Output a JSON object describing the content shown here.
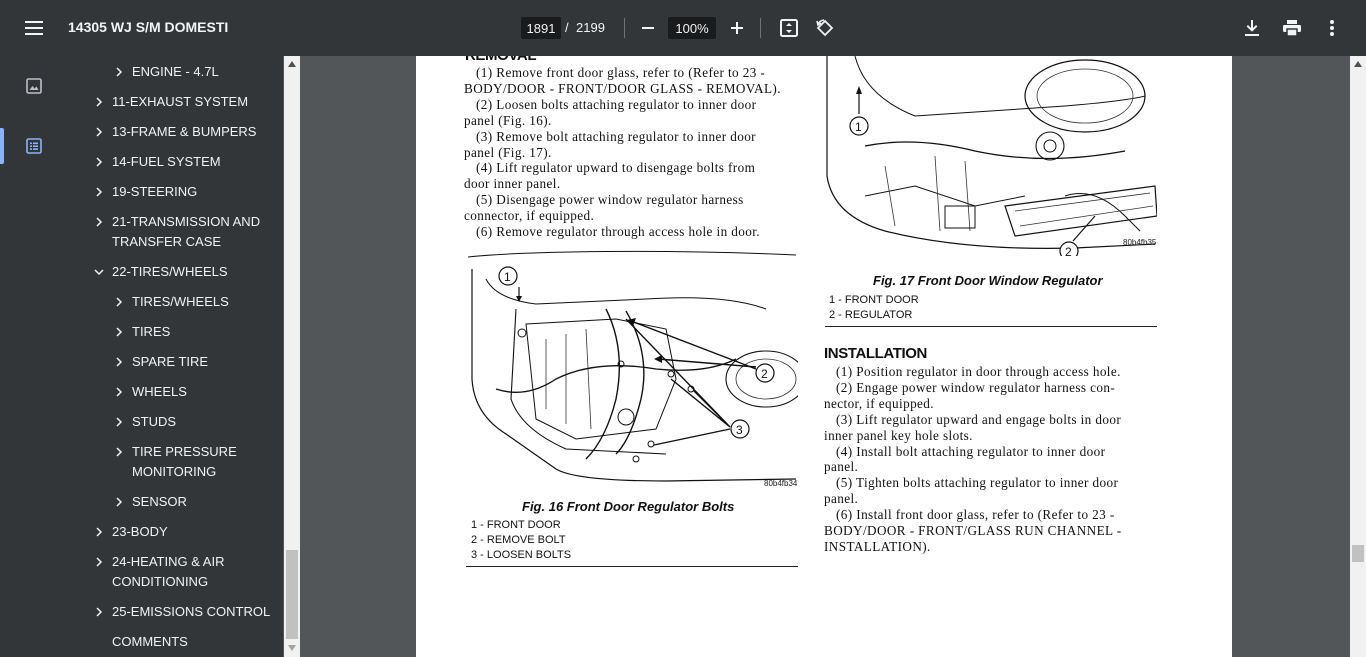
{
  "toolbar": {
    "title": "14305 WJ S/M DOMESTI",
    "page_current": "1891",
    "page_separator": "/",
    "page_total": "2199",
    "zoom": "100%"
  },
  "icons": {
    "menu": "hamburger-icon",
    "zoom_out": "minus-icon",
    "zoom_in": "plus-icon",
    "fit": "fit-page-icon",
    "rotate": "rotate-icon",
    "download": "download-icon",
    "print": "print-icon",
    "more": "more-vert-icon",
    "thumbnails": "image-icon",
    "outline": "outline-icon"
  },
  "outline": {
    "items": [
      {
        "label": "ENGINE - 4.7L",
        "indent": 1,
        "chevron": "right"
      },
      {
        "label": "11-EXHAUST SYSTEM",
        "indent": 0,
        "chevron": "right"
      },
      {
        "label": "13-FRAME & BUMPERS",
        "indent": 0,
        "chevron": "right"
      },
      {
        "label": "14-FUEL SYSTEM",
        "indent": 0,
        "chevron": "right"
      },
      {
        "label": "19-STEERING",
        "indent": 0,
        "chevron": "right"
      },
      {
        "label": "21-TRANSMISSION AND",
        "label2": "TRANSFER CASE",
        "indent": 0,
        "chevron": "right"
      },
      {
        "label": "22-TIRES/WHEELS",
        "indent": 0,
        "chevron": "down"
      },
      {
        "label": "TIRES/WHEELS",
        "indent": 1,
        "chevron": "right"
      },
      {
        "label": "TIRES",
        "indent": 1,
        "chevron": "right"
      },
      {
        "label": "SPARE TIRE",
        "indent": 1,
        "chevron": "right"
      },
      {
        "label": "WHEELS",
        "indent": 1,
        "chevron": "right"
      },
      {
        "label": "STUDS",
        "indent": 1,
        "chevron": "right"
      },
      {
        "label": "TIRE PRESSURE",
        "label2": "MONITORING",
        "indent": 1,
        "chevron": "right"
      },
      {
        "label": "SENSOR",
        "indent": 1,
        "chevron": "right"
      },
      {
        "label": "23-BODY",
        "indent": 0,
        "chevron": "right"
      },
      {
        "label": "24-HEATING & AIR",
        "label2": "CONDITIONING",
        "indent": 0,
        "chevron": "right"
      },
      {
        "label": "25-EMISSIONS CONTROL",
        "indent": 0,
        "chevron": "right"
      },
      {
        "label": "COMMENTS",
        "indent": 0,
        "chevron": "none"
      }
    ]
  },
  "document": {
    "removal_heading_partial": "REMOVAL",
    "removal_lines": [
      "(1) Remove front door glass, refer to (Refer to 23 -",
      "BODY/DOOR - FRONT/DOOR GLASS - REMOVAL).",
      "(2) Loosen bolts attaching regulator to inner door",
      "panel (Fig. 16).",
      "(3) Remove bolt attaching regulator to inner door",
      "panel (Fig. 17).",
      "(4) Lift regulator upward to disengage bolts from",
      "door inner panel.",
      "(5) Disengage power window regulator harness",
      "connector, if equipped.",
      "(6) Remove regulator through access hole in door."
    ],
    "fig16": {
      "code": "80b4fb34",
      "caption": "Fig. 16 Front Door Regulator Bolts",
      "callouts": [
        "1",
        "2",
        "3"
      ],
      "legend": [
        "1 - FRONT DOOR",
        "2 - REMOVE BOLT",
        "3 - LOOSEN BOLTS"
      ]
    },
    "fig17": {
      "code": "80b4fb35",
      "caption": "Fig. 17 Front Door Window Regulator",
      "callouts": [
        "1",
        "2"
      ],
      "legend": [
        "1 - FRONT DOOR",
        "2 - REGULATOR"
      ]
    },
    "installation_heading": "INSTALLATION",
    "installation_lines": [
      "(1) Position regulator in door through access hole.",
      "(2) Engage power window regulator harness con-",
      "nector, if equipped.",
      "(3) Lift regulator upward and engage bolts in door",
      "inner panel key hole slots.",
      "(4) Install bolt attaching regulator to inner door",
      "panel.",
      "(5) Tighten bolts attaching regulator to inner door",
      "panel.",
      "(6) Install front door glass, refer to (Refer to 23 -",
      "BODY/DOOR - FRONT/GLASS RUN CHANNEL -",
      "INSTALLATION)."
    ]
  }
}
